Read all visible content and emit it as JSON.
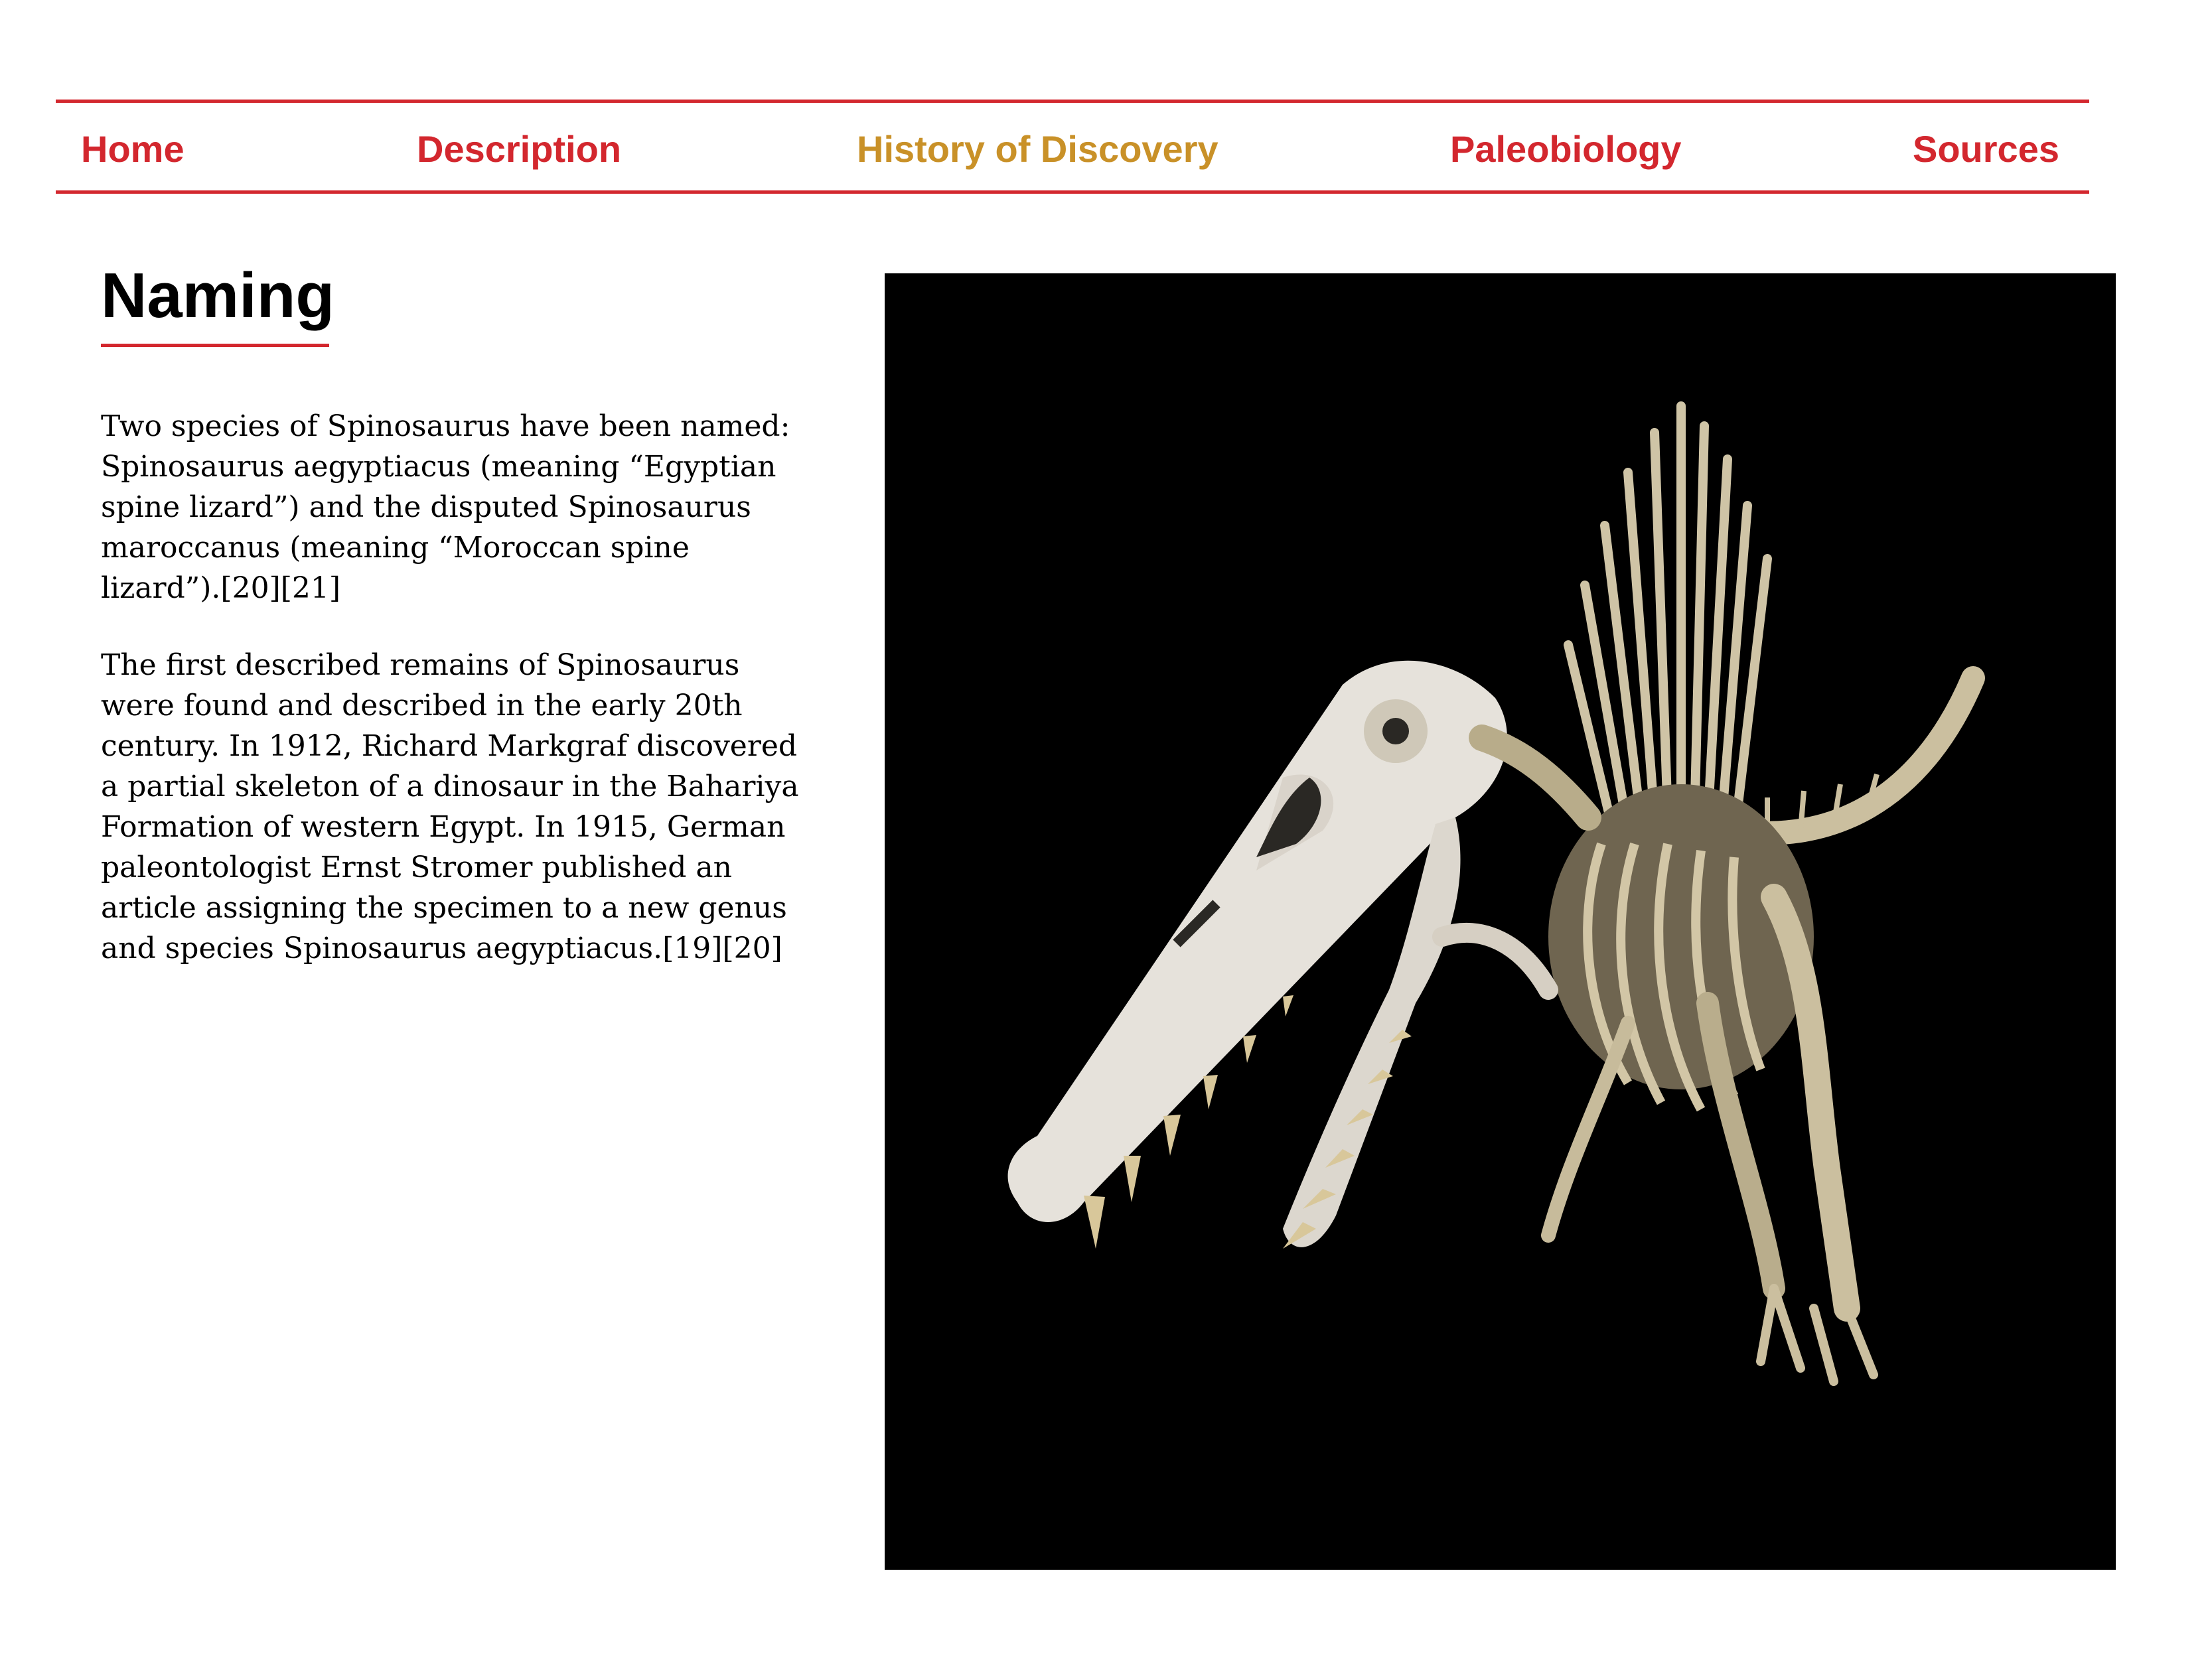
{
  "nav": {
    "items": [
      {
        "label": "Home",
        "active": false
      },
      {
        "label": "Description",
        "active": false
      },
      {
        "label": "History of Discovery",
        "active": true
      },
      {
        "label": "Paleobiology",
        "active": false
      },
      {
        "label": "Sources",
        "active": false
      }
    ]
  },
  "section": {
    "title": "Naming",
    "paragraphs": [
      "Two species of Spinosaurus have been named: Spinosaurus aegyptiacus (meaning “Egyptian spine lizard”) and the disputed Spinosaurus maroccanus (meaning “Moroccan spine lizard”).[20][21]",
      "The first described remains of Spinosaurus were found and described in the early 20th century. In 1912, Richard Markgraf discovered a partial skeleton of a dinosaur in the Bahariya Formation of western Egypt. In 1915, German paleontologist Ernst Stromer published an article assigning the specimen to a new genus and species Spinosaurus aegyptiacus.[19][20]"
    ]
  },
  "image": {
    "subject": "spinosaurus-skeleton",
    "background": "#000000"
  },
  "colors": {
    "accent": "#d3272e",
    "active_nav": "#c99128",
    "text": "#000000"
  }
}
